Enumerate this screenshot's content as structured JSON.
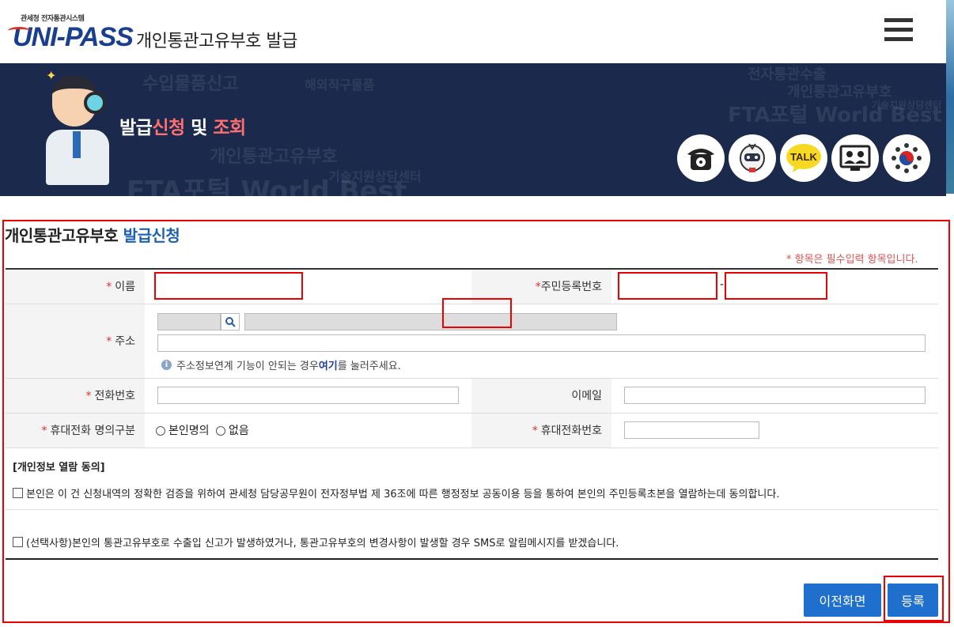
{
  "header": {
    "logo_small": "관세청 전자통관시스템",
    "logo": "UNI-PASS",
    "title": "개인통관고유부호  발급"
  },
  "banner": {
    "title_part1": "발급",
    "title_part2": "신청",
    "title_part3": " 및 ",
    "title_part4": "조회",
    "icons": [
      "phone-icon",
      "mascot-icon",
      "talk-icon",
      "video-call-icon",
      "government-emblem-icon"
    ],
    "talk_label": "TALK"
  },
  "form": {
    "title_black": "개인통관고유부호 ",
    "title_blue": "발급신청",
    "required_note": "* 항목은 필수입력 항목입니다.",
    "req_mark": "*",
    "name_label": "이름",
    "rrn_label": "주민등록번호",
    "rrn_separator": "-",
    "address_label": "주소",
    "address_info_prefix": "주소정보연계 기능이 안되는 경우 ",
    "address_info_link": "여기",
    "address_info_suffix": "를 눌러주세요.",
    "phone_label": "전화번호",
    "email_label": "이메일",
    "mobile_owner_label": "휴대전화 명의구분",
    "mobile_owner_options": [
      "본인명의",
      "없음"
    ],
    "mobile_label": "휴대전화번호"
  },
  "privacy": {
    "heading": "[개인정보 열람 동의]",
    "consent_text": "본인은 이 건 신청내역의 정확한 검증을 위하여 관세청 담당공무원이 전자정부법 제 36조에 따른 행정정보 공동이용 등을 통하여 본인의 주민등록초본을 열람하는데 동의합니다.",
    "sms_text": "(선택사항)본인의 통관고유부호로 수출입 신고가 발생하였거나, 통관고유부호의 변경사항이 발생할 경우 SMS로 알림메시지를 받겠습니다."
  },
  "buttons": {
    "back": "이전화면",
    "submit": "등록"
  },
  "colors": {
    "accent_blue": "#1e6fce",
    "banner_bg": "#1b2a4c",
    "highlight_red": "#e00000",
    "title_blue": "#1e61ae"
  }
}
